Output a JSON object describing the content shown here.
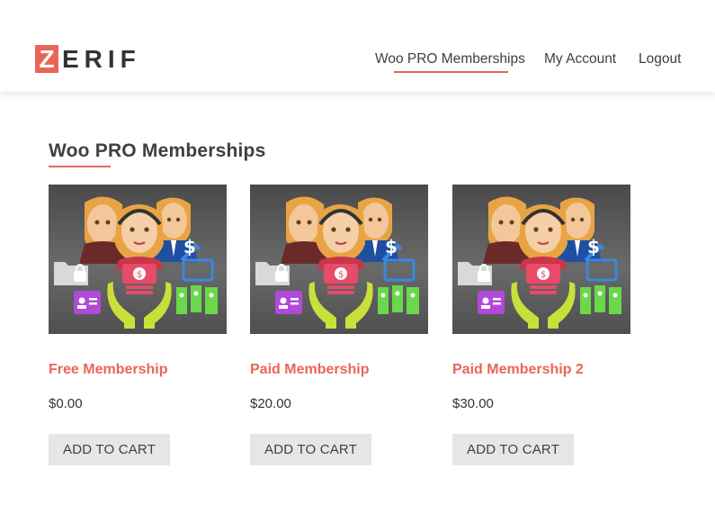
{
  "brand": {
    "logo_letter": "Z",
    "logo_rest": "ERIF"
  },
  "nav": {
    "items": [
      {
        "label": "Woo PRO Memberships"
      },
      {
        "label": "My Account"
      },
      {
        "label": "Logout"
      }
    ]
  },
  "main": {
    "title": "Woo PRO Memberships",
    "products": [
      {
        "name": "Free Membership",
        "price": "$0.00",
        "button": "ADD TO CART"
      },
      {
        "name": "Paid Membership",
        "price": "$20.00",
        "button": "ADD TO CART"
      },
      {
        "name": "Paid Membership 2",
        "price": "$30.00",
        "button": "ADD TO CART"
      }
    ]
  },
  "colors": {
    "accent": "#e96656",
    "text": "#404040",
    "button_bg": "#e6e6e6"
  },
  "icons": [
    "folder-lock-icon",
    "id-card-icon",
    "money-hands-icon",
    "dollar-transfer-icon",
    "bills-icon"
  ]
}
